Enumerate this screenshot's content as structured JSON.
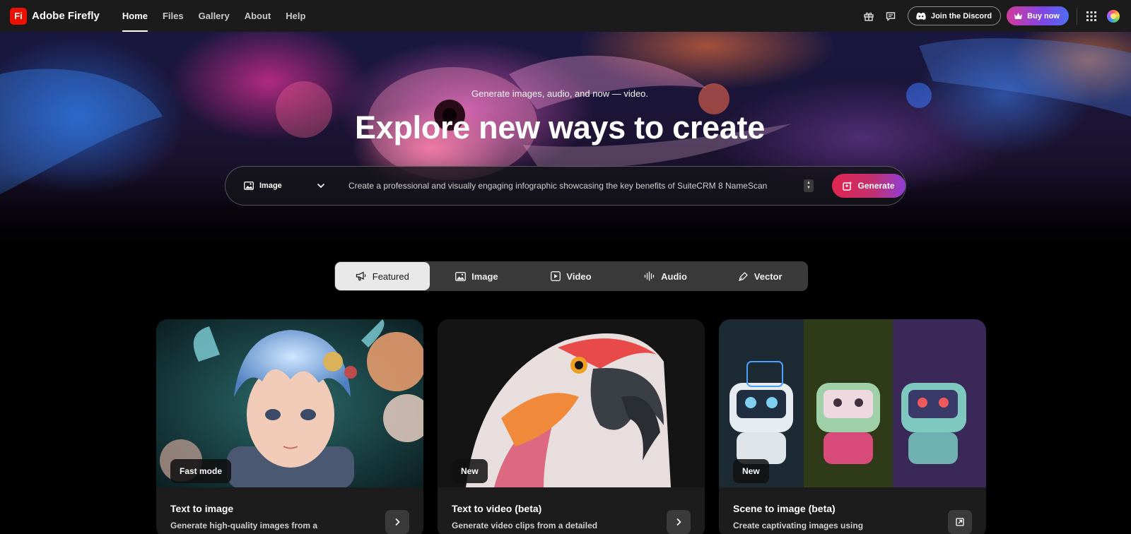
{
  "app": {
    "logo_text": "Fi",
    "name": "Adobe Firefly"
  },
  "nav": {
    "items": [
      {
        "label": "Home",
        "active": true
      },
      {
        "label": "Files",
        "active": false
      },
      {
        "label": "Gallery",
        "active": false
      },
      {
        "label": "About",
        "active": false
      },
      {
        "label": "Help",
        "active": false
      }
    ]
  },
  "header_actions": {
    "gift_icon": "gift-icon",
    "feedback_icon": "chat-icon",
    "discord_label": "Join the Discord",
    "buy_label": "Buy now",
    "apps_icon": "grid-icon",
    "avatar_icon": "avatar"
  },
  "hero": {
    "eyebrow": "Generate images, audio, and now — video.",
    "title": "Explore new ways to create"
  },
  "prompt": {
    "mode": "Image",
    "text": "Create a professional and visually engaging infographic showcasing the key benefits of SuiteCRM 8 NameScan",
    "generate_label": "Generate"
  },
  "tabs": [
    {
      "label": "Featured",
      "icon": "megaphone-icon",
      "active": true
    },
    {
      "label": "Image",
      "icon": "image-icon",
      "active": false
    },
    {
      "label": "Video",
      "icon": "video-icon",
      "active": false
    },
    {
      "label": "Audio",
      "icon": "audio-icon",
      "active": false
    },
    {
      "label": "Vector",
      "icon": "pen-icon",
      "active": false
    }
  ],
  "cards": [
    {
      "badge": "Fast mode",
      "title": "Text to image",
      "description": "Generate high-quality images from a",
      "action_icon": "chevron-right-icon"
    },
    {
      "badge": "New",
      "title": "Text to video (beta)",
      "description": "Generate video clips from a detailed",
      "action_icon": "chevron-right-icon"
    },
    {
      "badge": "New",
      "title": "Scene to image (beta)",
      "description": "Create captivating images using",
      "action_icon": "open-external-icon"
    }
  ],
  "colors": {
    "topbar_bg": "#1b1b1b",
    "brand_red": "#eb1000",
    "generate_gradient_start": "#e0264f",
    "generate_gradient_end": "#8f3fd6",
    "tab_bar_bg": "#3a3a3a",
    "card_bg": "#1c1c1c"
  }
}
